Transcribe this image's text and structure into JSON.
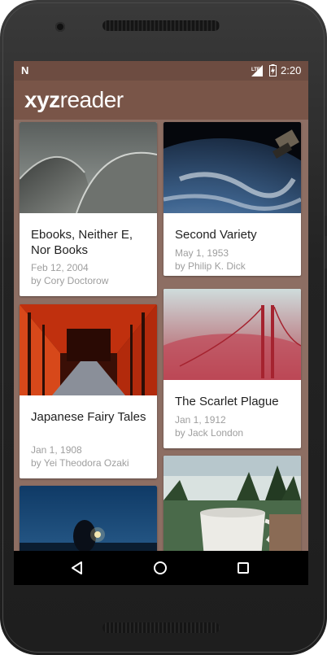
{
  "status_bar": {
    "notification": "N",
    "time": "2:20",
    "signal_label": "LTE"
  },
  "app": {
    "logo_bold": "xyz",
    "logo_light": "reader"
  },
  "articles": [
    {
      "title": "Ebooks, Neither E, Nor Books",
      "date": "Feb 12, 2004",
      "author": "by Cory Doctorow",
      "image": "architecture-dome-photo"
    },
    {
      "title": "Second Variety",
      "date": "May 1, 1953",
      "author": "by Philip K. Dick",
      "image": "earth-from-space-photo"
    },
    {
      "title": "Japanese Fairy Tales",
      "date": "Jan 1, 1908",
      "author": "by Yei Theodora Ozaki",
      "image": "torii-gates-photo"
    },
    {
      "title": "The Scarlet Plague",
      "date": "Jan 1, 1912",
      "author": "by Jack London",
      "image": "red-bridge-fog-photo"
    },
    {
      "title": "",
      "date": "",
      "author": "",
      "image": "night-lantern-photo"
    },
    {
      "title": "",
      "date": "",
      "author": "",
      "image": "mug-lake-photo"
    }
  ],
  "nav_bar": {
    "back": "back-icon",
    "home": "home-icon",
    "recents": "recents-icon"
  },
  "colors": {
    "primary": "#795548",
    "primary_dark": "#6d4c41",
    "background": "#8d6e63"
  }
}
